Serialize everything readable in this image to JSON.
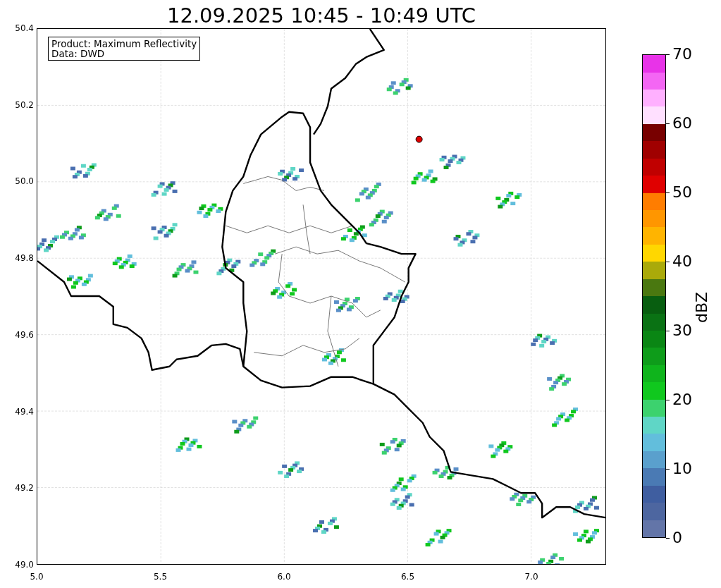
{
  "title": "12.09.2025 10:45 - 10:49 UTC",
  "legend": {
    "lines": [
      "Product: Maximum Reflectivity",
      "Data: DWD"
    ]
  },
  "axes": {
    "yticks": [
      "50.4",
      "50.2",
      "50.0",
      "49.8",
      "49.6",
      "49.4",
      "49.2",
      "49.0"
    ],
    "xticks": [
      "5.0",
      "5.5",
      "6.0",
      "6.5",
      "7.0"
    ]
  },
  "colorbar": {
    "label": "dBZ",
    "ticks": [
      "70",
      "60",
      "50",
      "40",
      "30",
      "20",
      "10",
      "0"
    ],
    "segments": [
      {
        "color": "#6375a8"
      },
      {
        "color": "#4d66a0"
      },
      {
        "color": "#3f5ea0"
      },
      {
        "color": "#4a7ab4"
      },
      {
        "color": "#5aa0cd"
      },
      {
        "color": "#62bedc"
      },
      {
        "color": "#5fd6c6"
      },
      {
        "color": "#3cd26e"
      },
      {
        "color": "#10c81e"
      },
      {
        "color": "#0fb41c"
      },
      {
        "color": "#0e9c1a"
      },
      {
        "color": "#0a8614"
      },
      {
        "color": "#0a7214"
      },
      {
        "color": "#085e10"
      },
      {
        "color": "#4a7810"
      },
      {
        "color": "#aaaa0a"
      },
      {
        "color": "#ffd700"
      },
      {
        "color": "#ffb400"
      },
      {
        "color": "#ff9600"
      },
      {
        "color": "#ff7d00"
      },
      {
        "color": "#e00000"
      },
      {
        "color": "#c00000"
      },
      {
        "color": "#a00000"
      },
      {
        "color": "#780000"
      },
      {
        "color": "#ffe0ff"
      },
      {
        "color": "#ffb0ff"
      },
      {
        "color": "#f466f4"
      },
      {
        "color": "#e833e8"
      }
    ]
  }
}
